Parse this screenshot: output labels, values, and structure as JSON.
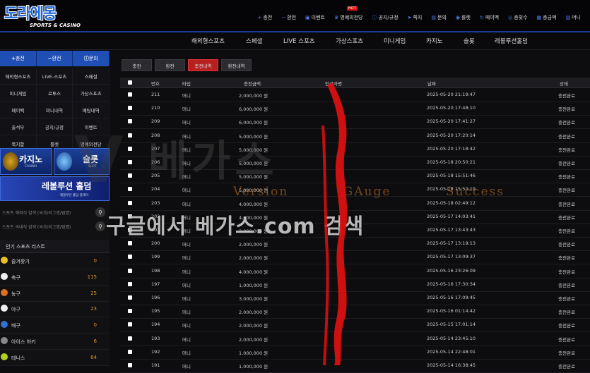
{
  "header": {
    "logo_text": "도라에몽",
    "logo_sub": "SPORTS & CASINO",
    "nav": [
      {
        "icon": "plus-icon",
        "label": "충전"
      },
      {
        "icon": "minus-icon",
        "label": "환전"
      },
      {
        "icon": "gift-icon",
        "label": "이벤트"
      },
      {
        "icon": "trophy-icon",
        "label": "명예의전당",
        "badge": "HOT"
      },
      {
        "icon": "info-icon",
        "label": "공지/규정"
      },
      {
        "icon": "send-icon",
        "label": "쪽지"
      },
      {
        "icon": "chat-icon",
        "label": "문의"
      },
      {
        "icon": "roulette-icon",
        "label": "룰렛"
      },
      {
        "icon": "payback-icon",
        "label": "페이백"
      },
      {
        "icon": "coin-icon",
        "label": "충횟수"
      },
      {
        "icon": "wallet-icon",
        "label": "충금액"
      },
      {
        "icon": "money-icon",
        "label": "머니"
      }
    ]
  },
  "catbar": [
    "해외형스포츠",
    "스페셜",
    "LIVE 스포츠",
    "가상스포츠",
    "미니게임",
    "카지노",
    "슬롯",
    "레볼루션홀덤"
  ],
  "sidebar": {
    "buttons": [
      {
        "icon": "plus-icon",
        "label": "충전"
      },
      {
        "icon": "minus-icon",
        "label": "환전"
      },
      {
        "icon": "info-icon",
        "label": "문의"
      }
    ],
    "grid": [
      "해외형스포츠",
      "LIVE-스포츠",
      "스페셜",
      "미니게임",
      "로투스",
      "가상스포츠",
      "페이백",
      "미니내역",
      "배팅내역",
      "출석부",
      "공지/규정",
      "이벤트",
      "쪽지함",
      "룰렛",
      "명예의전당"
    ],
    "banners": {
      "casino": {
        "title": "카지노",
        "sub": "CASINO"
      },
      "slot": {
        "title": "슬롯",
        "sub": "SLOT"
      },
      "holdem": {
        "title": "레볼루션 홀덤",
        "sub": "레볼루션 홀덤 플레이"
      }
    },
    "search_overseas": "스포츠 해외식 검색 (국가/리그명/팀명)",
    "search_domestic": "스포츠 국내식 검색 (국가/리그명/팀명)",
    "popular_title": "인기 스포츠 리스트",
    "sports": [
      {
        "name": "즐겨찾기",
        "count": "0",
        "color": "#e8c020"
      },
      {
        "name": "축구",
        "count": "115",
        "color": "#eeeeee"
      },
      {
        "name": "농구",
        "count": "25",
        "color": "#e07020"
      },
      {
        "name": "야구",
        "count": "23",
        "color": "#f0f0f0"
      },
      {
        "name": "배구",
        "count": "0",
        "color": "#3070d0"
      },
      {
        "name": "아이스 하키",
        "count": "6",
        "color": "#888888"
      },
      {
        "name": "테니스",
        "count": "64",
        "color": "#b0d020"
      }
    ]
  },
  "main": {
    "tabs": [
      "충전",
      "환전",
      "충전내역",
      "환전내역"
    ],
    "active_tab": 2,
    "columns": [
      "번호",
      "타입",
      "충전금액",
      "입금자명",
      "날짜",
      "상태"
    ],
    "rows": [
      {
        "no": "211",
        "type": "머니",
        "amount": "2,000,000 원",
        "date": "2025-05-20 21:19:47",
        "status": "충전완료"
      },
      {
        "no": "210",
        "type": "머니",
        "amount": "6,000,000 원",
        "date": "2025-05-20 17:48:10",
        "status": "충전완료"
      },
      {
        "no": "209",
        "type": "머니",
        "amount": "6,000,000 원",
        "date": "2025-05-20 17:41:27",
        "status": "충전완료"
      },
      {
        "no": "208",
        "type": "머니",
        "amount": "5,000,000 원",
        "date": "2025-05-20 17:20:14",
        "status": "충전완료"
      },
      {
        "no": "207",
        "type": "머니",
        "amount": "5,000,000 원",
        "date": "2025-05-20 17:18:42",
        "status": "충전완료"
      },
      {
        "no": "206",
        "type": "머니",
        "amount": "5,000,000 원",
        "date": "2025-05-18 20:50:21",
        "status": "충전완료"
      },
      {
        "no": "205",
        "type": "머니",
        "amount": "5,000,000 원",
        "date": "2025-05-18 15:51:46",
        "status": "충전완료"
      },
      {
        "no": "204",
        "type": "머니",
        "amount": "5,000,000 원",
        "date": "2025-05-18 15:50:19",
        "status": "충전완료"
      },
      {
        "no": "203",
        "type": "머니",
        "amount": "4,000,000 원",
        "date": "2025-05-18 02:49:12",
        "status": "충전완료"
      },
      {
        "no": "202",
        "type": "머니",
        "amount": "4,000,000 원",
        "date": "2025-05-17 14:03:41",
        "status": "충전완료"
      },
      {
        "no": "201",
        "type": "머니",
        "amount": "3,000,000 원",
        "date": "2025-05-17 13:43:43",
        "status": "충전완료"
      },
      {
        "no": "200",
        "type": "머니",
        "amount": "2,000,000 원",
        "date": "2025-05-17 13:19:13",
        "status": "충전완료"
      },
      {
        "no": "199",
        "type": "머니",
        "amount": "2,000,000 원",
        "date": "2025-05-17 13:09:37",
        "status": "충전완료"
      },
      {
        "no": "198",
        "type": "머니",
        "amount": "4,000,000 원",
        "date": "2025-05-16 23:26:09",
        "status": "충전완료"
      },
      {
        "no": "197",
        "type": "머니",
        "amount": "1,000,000 원",
        "date": "2025-05-16 17:30:34",
        "status": "충전완료"
      },
      {
        "no": "196",
        "type": "머니",
        "amount": "3,000,000 원",
        "date": "2025-05-16 17:09:45",
        "status": "충전완료"
      },
      {
        "no": "195",
        "type": "머니",
        "amount": "2,000,000 원",
        "date": "2025-05-16 01:14:42",
        "status": "충전완료"
      },
      {
        "no": "194",
        "type": "머니",
        "amount": "2,000,000 원",
        "date": "2025-05-15 17:01:14",
        "status": "충전완료"
      },
      {
        "no": "193",
        "type": "머니",
        "amount": "2,000,000 원",
        "date": "2025-05-14 23:45:10",
        "status": "충전완료"
      },
      {
        "no": "192",
        "type": "머니",
        "amount": "1,000,000 원",
        "date": "2025-05-14 22:48:01",
        "status": "충전완료"
      },
      {
        "no": "191",
        "type": "머니",
        "amount": "1,000,000 원",
        "date": "2025-05-14 16:38:45",
        "status": "충전완료"
      }
    ]
  },
  "watermark": {
    "big": "베가스",
    "mid_left": "Version",
    "mid_center": "GAuge",
    "mid_right": "Success",
    "search_text": "구글에서 베가스.com 검색"
  }
}
